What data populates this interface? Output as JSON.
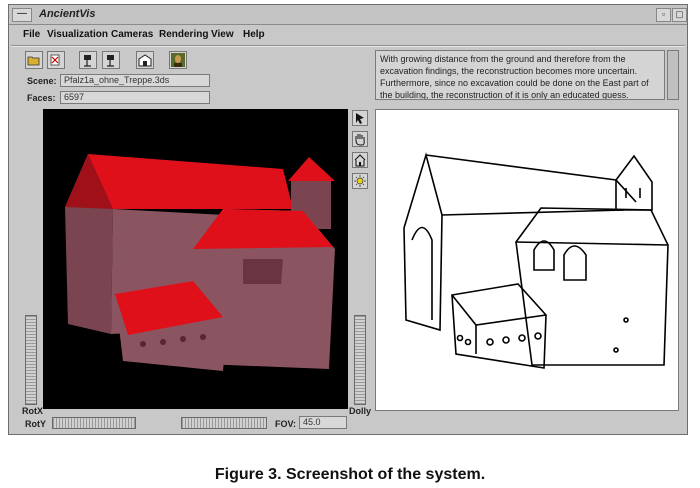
{
  "window": {
    "title": "AncientVis",
    "menu_glyph": "—",
    "min_glyph": "▫",
    "max_glyph": "▢"
  },
  "menubar": [
    "File",
    "Visualization",
    "Cameras",
    "Rendering",
    "View",
    "Help"
  ],
  "toolbar": [
    {
      "icon": "open-folder-icon"
    },
    {
      "icon": "reload-icon"
    },
    {
      "icon": "camera-flag-icon"
    },
    {
      "icon": "camera-flag-icon-2"
    },
    {
      "icon": "building-icon"
    },
    {
      "icon": "portrait-icon"
    }
  ],
  "scene": {
    "label": "Scene:",
    "value": "Pfalz1a_ohne_Treppe.3ds"
  },
  "faces": {
    "label": "Faces:",
    "value": "6597"
  },
  "info_text": "With growing distance from the ground and therefore from the excavation findings, the reconstruction becomes more uncertain. Furthermore, since no excavation could be done on the East part of the building, the reconstruction of it is only an educated guess.",
  "side_tools": [
    {
      "icon": "arrow-pointer-icon"
    },
    {
      "icon": "hand-icon"
    },
    {
      "icon": "home-icon"
    },
    {
      "icon": "light-icon"
    }
  ],
  "controls": {
    "rotx_label": "RotX",
    "roty_label": "RotY",
    "dolly_label": "Dolly",
    "fov_label": "FOV:",
    "fov_value": "45.0"
  },
  "colors": {
    "roof": "#e0101a",
    "wall": "#7a4550",
    "viewport_bg": "#000000"
  },
  "caption": "Figure 3. Screenshot of the system."
}
